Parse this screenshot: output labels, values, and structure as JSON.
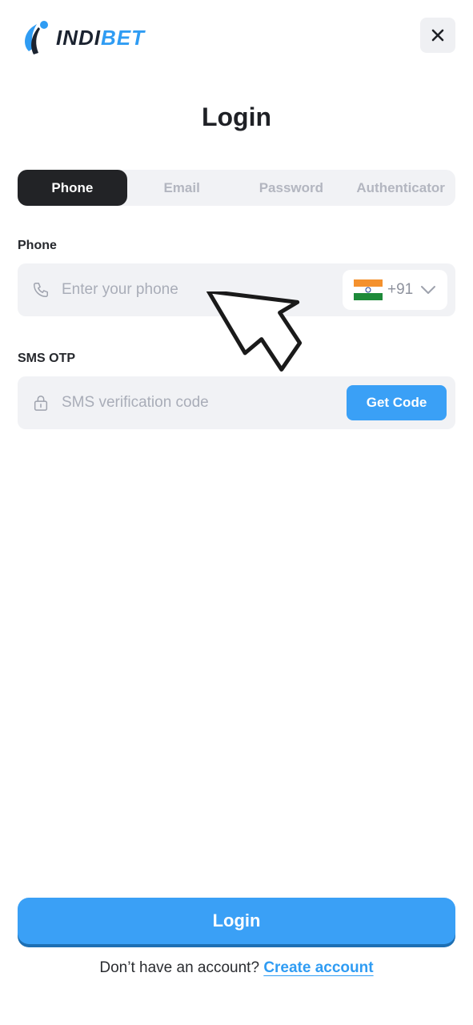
{
  "brand": {
    "logo_text_a": "INDI",
    "logo_text_b": "BET",
    "colors": {
      "dark": "#1b2330",
      "blue": "#2f9cf3"
    }
  },
  "header": {
    "close_icon": "close-icon"
  },
  "page": {
    "title": "Login"
  },
  "tabs": [
    {
      "label": "Phone",
      "active": true
    },
    {
      "label": "Email",
      "active": false
    },
    {
      "label": "Password",
      "active": false
    },
    {
      "label": "Authenticator",
      "active": false
    }
  ],
  "phone_field": {
    "label": "Phone",
    "placeholder": "Enter your phone",
    "value": "",
    "icon": "phone-icon",
    "country": {
      "flag": "india-flag-icon",
      "dial_code": "+91"
    }
  },
  "otp_field": {
    "label": "SMS OTP",
    "placeholder": "SMS verification code",
    "value": "",
    "icon": "lock-icon",
    "button_label": "Get Code"
  },
  "footer": {
    "login_label": "Login",
    "signup_prompt": "Don’t have an account?",
    "signup_link": "Create account"
  },
  "colors": {
    "accent": "#3aa0f6",
    "tab_active_bg": "#222326",
    "field_bg": "#f1f2f5"
  }
}
